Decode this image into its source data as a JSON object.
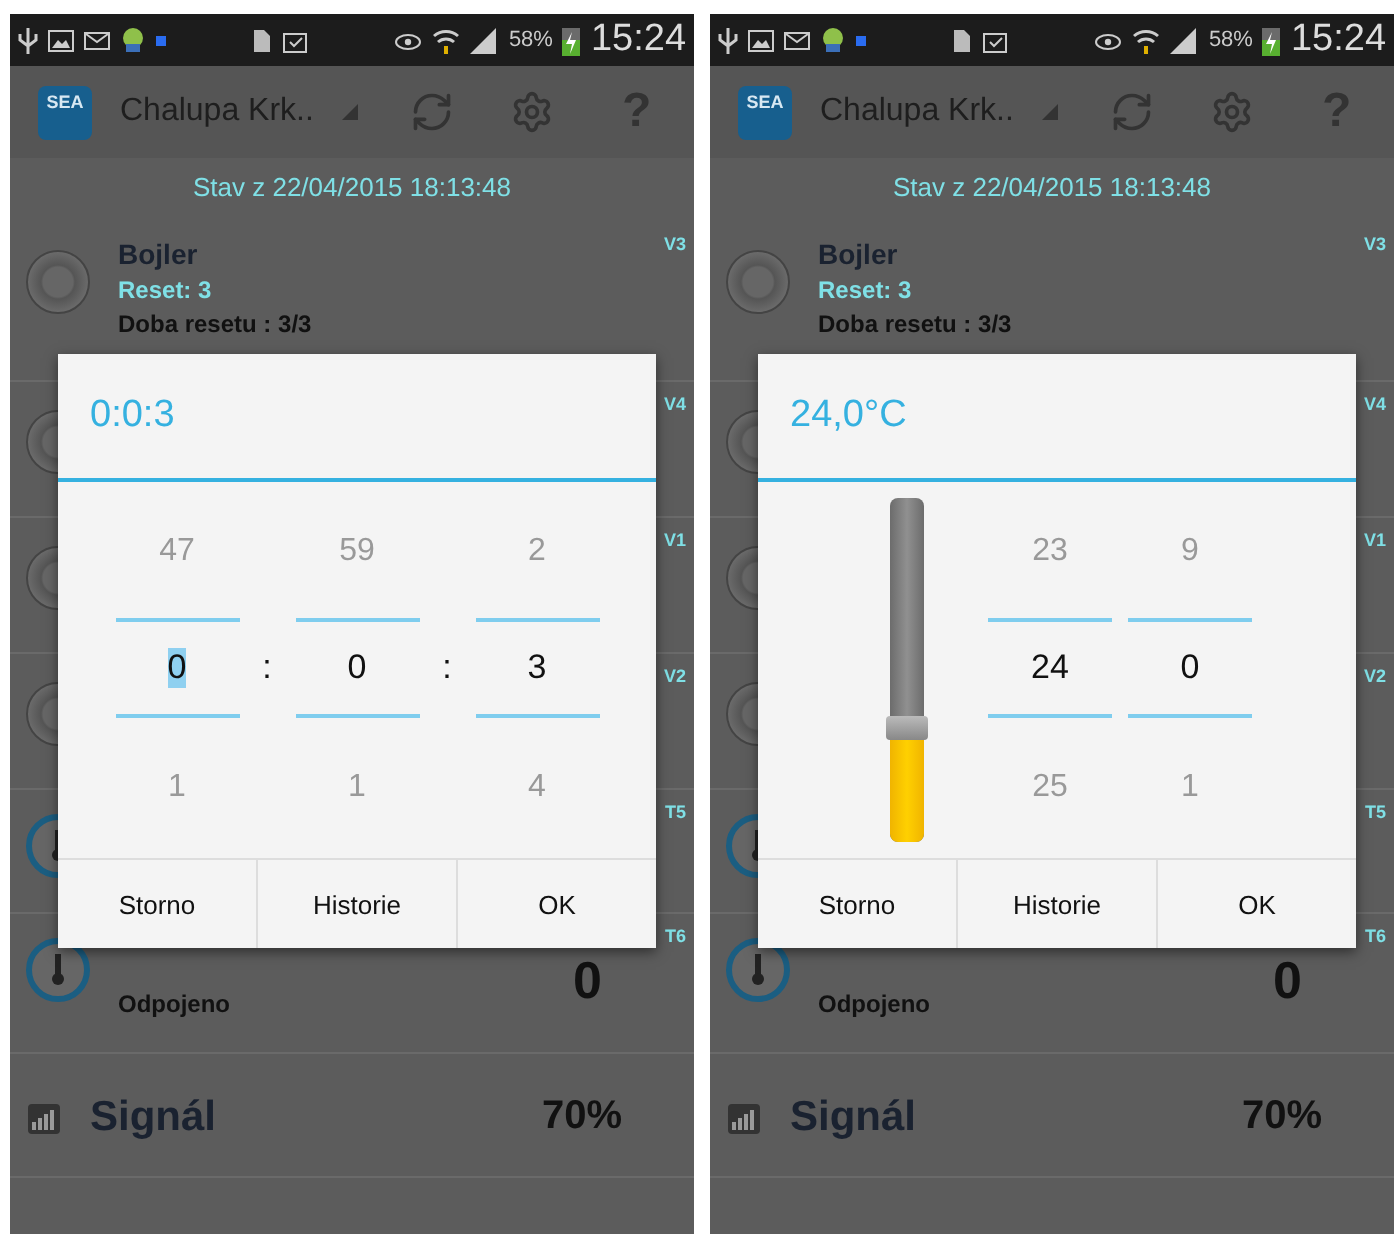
{
  "screens": [
    {
      "status_bar": {
        "battery": "58%",
        "time": "15:24"
      },
      "app_bar": {
        "logo_text": "SEA",
        "title": "Chalupa Krk..",
        "help": "?"
      },
      "status_line": "Stav z 22/04/2015 18:13:48",
      "rows": [
        {
          "kind": "switch",
          "on": false,
          "name": "Bojler",
          "detail": "Reset: 3",
          "note": "Doba resetu : 3/3",
          "tag": "V3"
        },
        {
          "kind": "switch",
          "on": false,
          "tag": "V4"
        },
        {
          "kind": "switch",
          "on": false,
          "tag": "V1"
        },
        {
          "kind": "switch",
          "on": false,
          "tag": "V2"
        },
        {
          "kind": "sensor",
          "tag": "T5"
        },
        {
          "kind": "sensor",
          "tag": "T6",
          "value": "0",
          "note": "Odpojeno"
        },
        {
          "kind": "signal",
          "name": "Signál",
          "value": "70%"
        }
      ],
      "dialog": {
        "kind": "time",
        "title": "0:0:3",
        "separators": [
          ":",
          ":"
        ],
        "columns": [
          {
            "above": "47",
            "value": "0",
            "below": "1",
            "selected": true
          },
          {
            "above": "59",
            "value": "0",
            "below": "1",
            "selected": false
          },
          {
            "above": "2",
            "value": "3",
            "below": "4",
            "selected": false
          }
        ],
        "buttons": [
          "Storno",
          "Historie",
          "OK"
        ]
      }
    },
    {
      "status_bar": {
        "battery": "58%",
        "time": "15:24"
      },
      "app_bar": {
        "logo_text": "SEA",
        "title": "Chalupa Krk..",
        "help": "?"
      },
      "status_line": "Stav z 22/04/2015 18:13:48",
      "rows": [
        {
          "kind": "switch",
          "on": false,
          "name": "Bojler",
          "detail": "Reset: 3",
          "note": "Doba resetu : 3/3",
          "tag": "V3"
        },
        {
          "kind": "switch",
          "on": false,
          "tag": "V4"
        },
        {
          "kind": "switch",
          "on": false,
          "tag": "V1"
        },
        {
          "kind": "switch",
          "on": false,
          "tag": "V2"
        },
        {
          "kind": "sensor",
          "tag": "T5"
        },
        {
          "kind": "sensor",
          "tag": "T6",
          "value": "0",
          "note": "Odpojeno"
        },
        {
          "kind": "signal",
          "name": "Signál",
          "value": "70%"
        }
      ],
      "dialog": {
        "kind": "temperature",
        "title": "24,0°C",
        "level": 0.33,
        "columns": [
          {
            "above": "23",
            "value": "24",
            "below": "25",
            "selected": false
          },
          {
            "above": "9",
            "value": "0",
            "below": "1",
            "selected": false
          }
        ],
        "buttons": [
          "Storno",
          "Historie",
          "OK"
        ]
      }
    }
  ]
}
